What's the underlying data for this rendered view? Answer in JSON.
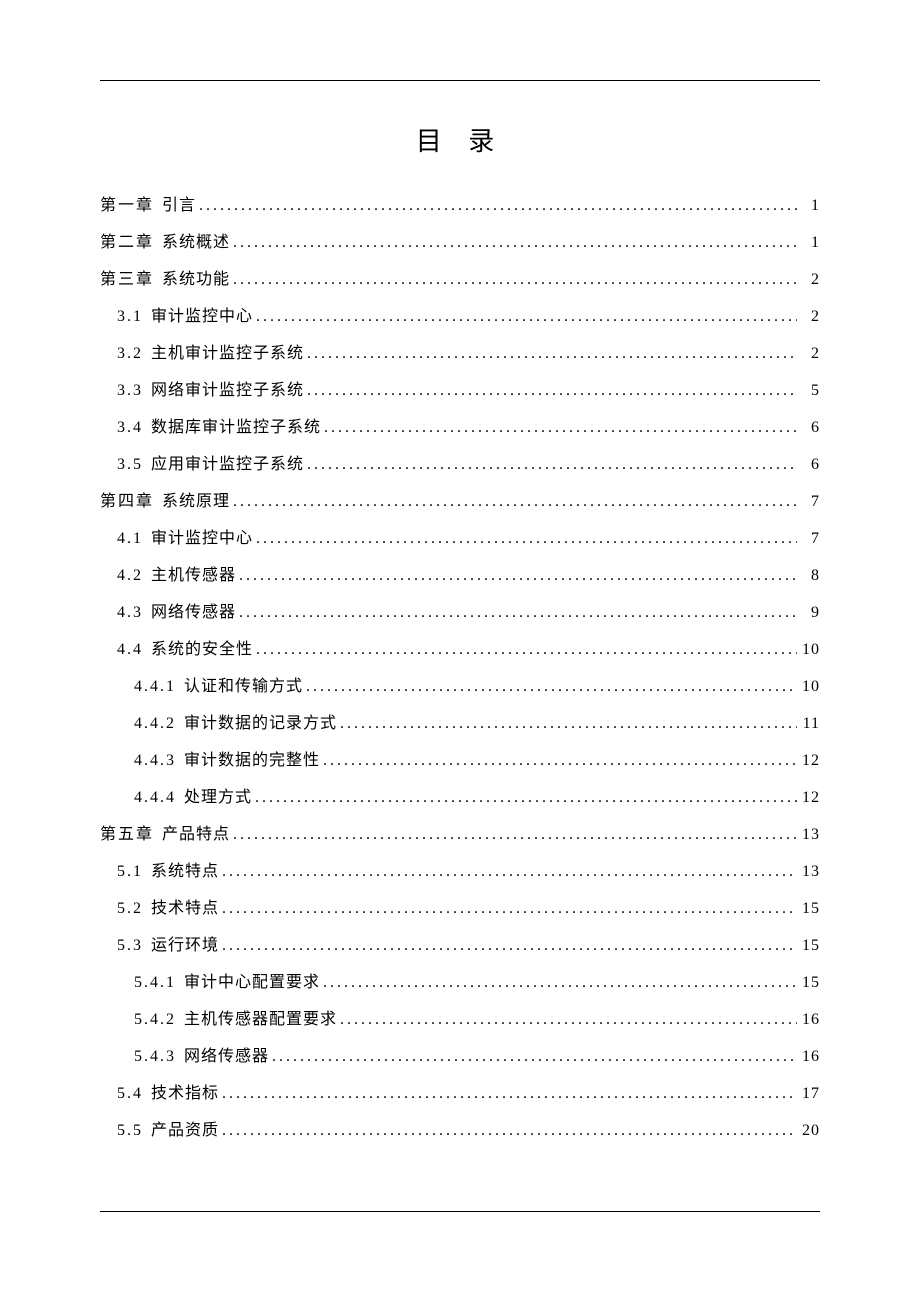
{
  "title": "目 录",
  "entries": [
    {
      "num": "第一章",
      "text": "引言",
      "page": "1",
      "level": "chapter"
    },
    {
      "num": "第二章",
      "text": "系统概述",
      "page": "1",
      "level": "chapter"
    },
    {
      "num": "第三章",
      "text": "系统功能",
      "page": "2",
      "level": "chapter"
    },
    {
      "num": "3.1",
      "text": "审计监控中心",
      "page": "2",
      "level": "1"
    },
    {
      "num": "3.2",
      "text": "主机审计监控子系统",
      "page": "2",
      "level": "1"
    },
    {
      "num": "3.3",
      "text": "网络审计监控子系统",
      "page": "5",
      "level": "1"
    },
    {
      "num": "3.4",
      "text": "数据库审计监控子系统",
      "page": "6",
      "level": "1"
    },
    {
      "num": "3.5",
      "text": "应用审计监控子系统",
      "page": "6",
      "level": "1"
    },
    {
      "num": "第四章",
      "text": "系统原理",
      "page": "7",
      "level": "chapter"
    },
    {
      "num": "4.1",
      "text": "审计监控中心",
      "page": "7",
      "level": "1"
    },
    {
      "num": "4.2",
      "text": "主机传感器",
      "page": "8",
      "level": "1"
    },
    {
      "num": "4.3",
      "text": "网络传感器",
      "page": "9",
      "level": "1"
    },
    {
      "num": "4.4",
      "text": "系统的安全性",
      "page": "10",
      "level": "1"
    },
    {
      "num": "4.4.1",
      "text": "认证和传输方式",
      "page": "10",
      "level": "2"
    },
    {
      "num": "4.4.2",
      "text": "审计数据的记录方式",
      "page": "11",
      "level": "2"
    },
    {
      "num": "4.4.3",
      "text": "审计数据的完整性",
      "page": "12",
      "level": "2"
    },
    {
      "num": "4.4.4",
      "text": "处理方式",
      "page": "12",
      "level": "2"
    },
    {
      "num": "第五章",
      "text": "产品特点",
      "page": "13",
      "level": "chapter"
    },
    {
      "num": "5.1",
      "text": "系统特点",
      "page": "13",
      "level": "1"
    },
    {
      "num": "5.2",
      "text": "技术特点",
      "page": "15",
      "level": "1"
    },
    {
      "num": "5.3",
      "text": "运行环境",
      "page": "15",
      "level": "1"
    },
    {
      "num": "5.4.1",
      "text": "审计中心配置要求",
      "page": "15",
      "level": "2"
    },
    {
      "num": "5.4.2",
      "text": "主机传感器配置要求",
      "page": "16",
      "level": "2"
    },
    {
      "num": "5.4.3",
      "text": "网络传感器",
      "page": "16",
      "level": "2"
    },
    {
      "num": "5.4",
      "text": "技术指标",
      "page": "17",
      "level": "1"
    },
    {
      "num": "5.5",
      "text": "产品资质",
      "page": "20",
      "level": "1"
    }
  ]
}
